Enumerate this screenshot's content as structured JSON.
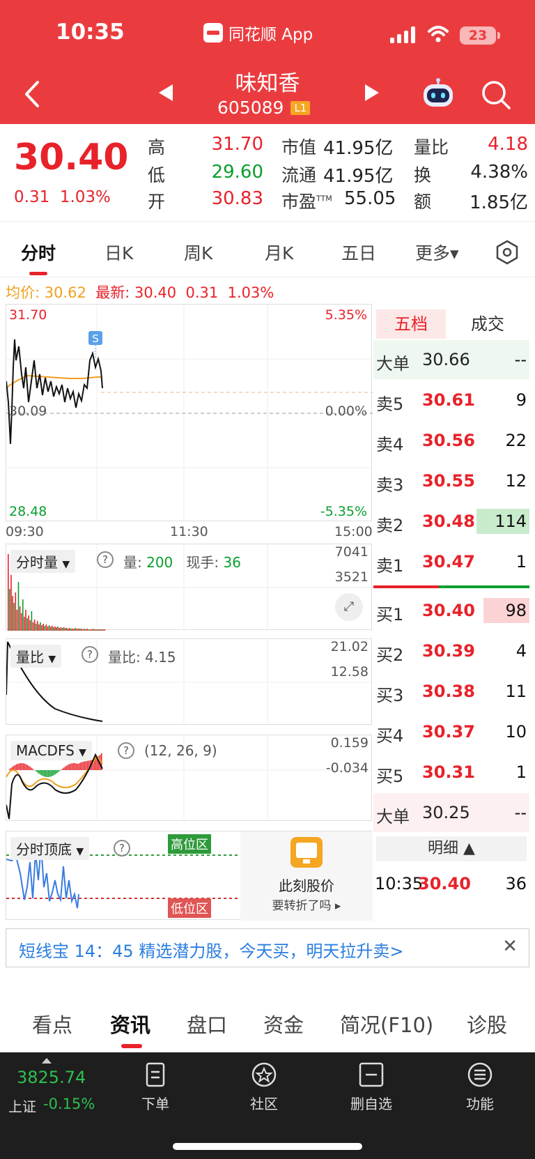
{
  "status": {
    "time": "10:35",
    "app": "同花顺 App",
    "battery": "23"
  },
  "stock": {
    "name": "味知香",
    "code": "605089",
    "level": "L1"
  },
  "quote": {
    "price": "30.40",
    "change": "0.31",
    "change_pct": "1.03%",
    "high_label": "高",
    "high": "31.70",
    "low_label": "低",
    "low": "29.60",
    "open_label": "开",
    "open": "30.83",
    "mktcap_label": "市值",
    "mktcap": "41.95亿",
    "float_label": "流通",
    "float": "41.95亿",
    "pe_label": "市盈",
    "pe_sup": "TTM",
    "pe": "55.05",
    "volratio_label": "量比",
    "volratio": "4.18",
    "turnover_label": "换",
    "turnover": "4.38%",
    "amount_label": "额",
    "amount": "1.85亿"
  },
  "tabs": [
    "分时",
    "日K",
    "周K",
    "月K",
    "五日",
    "更多▾"
  ],
  "info": {
    "avg_label": "均价:",
    "avg": "30.62",
    "latest_label": "最新:",
    "latest": "30.40",
    "chg": "0.31",
    "pct": "1.03%"
  },
  "chart": {
    "top_price": "31.70",
    "top_pct": "5.35%",
    "mid_price": "30.09",
    "mid_pct": "0.00%",
    "bot_price": "28.48",
    "bot_pct": "-5.35%",
    "t_start": "09:30",
    "t_mid": "11:30",
    "t_end": "15:00",
    "marker": "S"
  },
  "vol_panel": {
    "title": "分时量",
    "q": "?",
    "vol_label": "量:",
    "vol": "200",
    "hand_label": "现手:",
    "hand": "36",
    "axis_top": "7041",
    "axis_mid": "3521"
  },
  "vr_panel": {
    "title": "量比",
    "q": "?",
    "text": "量比: 4.15",
    "axis_top": "21.02",
    "axis_mid": "12.58"
  },
  "macd_panel": {
    "title": "MACDFS",
    "q": "?",
    "params": "(12, 26, 9)",
    "axis_top": "0.159",
    "axis_mid": "-0.034"
  },
  "top_panel": {
    "title": "分时顶底",
    "q": "?",
    "high_zone": "高位区",
    "low_zone": "低位区",
    "ad_title": "此刻股价",
    "ad_sub": "要转折了吗 ▸"
  },
  "book": {
    "tab1": "五档",
    "tab2": "成交",
    "big_sell": {
      "label": "大单",
      "price": "30.66",
      "vol": "--"
    },
    "sells": [
      {
        "label": "卖5",
        "price": "30.61",
        "vol": "9"
      },
      {
        "label": "卖4",
        "price": "30.56",
        "vol": "22"
      },
      {
        "label": "卖3",
        "price": "30.55",
        "vol": "12"
      },
      {
        "label": "卖2",
        "price": "30.48",
        "vol": "114"
      },
      {
        "label": "卖1",
        "price": "30.47",
        "vol": "1"
      }
    ],
    "buys": [
      {
        "label": "买1",
        "price": "30.40",
        "vol": "98"
      },
      {
        "label": "买2",
        "price": "30.39",
        "vol": "4"
      },
      {
        "label": "买3",
        "price": "30.38",
        "vol": "11"
      },
      {
        "label": "买4",
        "price": "30.37",
        "vol": "10"
      },
      {
        "label": "买5",
        "price": "30.31",
        "vol": "1"
      }
    ],
    "big_buy": {
      "label": "大单",
      "price": "30.25",
      "vol": "--"
    },
    "detail_label": "明细 ▲",
    "detail": {
      "time": "10:35",
      "price": "30.40",
      "vol": "36"
    }
  },
  "banner": {
    "text": "短线宝 14：45 精选潜力股，今天买，明天拉升卖>",
    "close": "✕"
  },
  "subtabs": [
    "看点",
    "资讯",
    "盘口",
    "资金",
    "简况(F10)",
    "诊股"
  ],
  "bottom": {
    "index_value": "3825.74",
    "index_name": "上证",
    "index_chg": "-0.15%",
    "items": [
      "下单",
      "社区",
      "删自选",
      "功能"
    ]
  },
  "colors": {
    "header": "#ea3c3f",
    "up": "#e8222a",
    "down": "#0a9e2e",
    "avg": "#f0a020"
  }
}
